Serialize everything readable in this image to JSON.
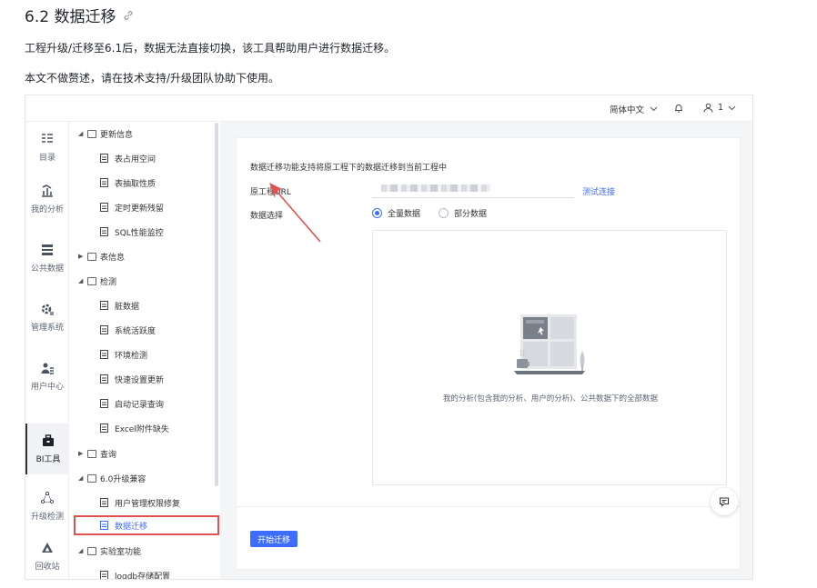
{
  "doc": {
    "title": "6.2 数据迁移",
    "para1": "工程升级/迁移至6.1后，数据无法直接切换，该工具帮助用户进行数据迁移。",
    "para2": "本文不做赘述，请在技术支持/升级团队协助下使用。"
  },
  "topbar": {
    "language": "简体中文",
    "user": "1"
  },
  "rail": [
    {
      "label": "目录",
      "icon": "catalog-icon"
    },
    {
      "label": "我的分析",
      "icon": "analysis-icon"
    },
    {
      "label": "公共数据",
      "icon": "public-data-icon"
    },
    {
      "label": "管理系统",
      "icon": "manage-system-icon"
    },
    {
      "label": "用户中心",
      "icon": "user-center-icon"
    },
    {
      "label": "BI工具",
      "icon": "bi-tools-icon",
      "active": true
    },
    {
      "label": "升级检测",
      "icon": "upgrade-check-icon"
    },
    {
      "label": "回收站",
      "icon": "recycle-bin-icon"
    }
  ],
  "tree": [
    {
      "type": "folder",
      "label": "更新信息",
      "expanded": true
    },
    {
      "type": "leaf",
      "label": "表占用空间"
    },
    {
      "type": "leaf",
      "label": "表抽取性质"
    },
    {
      "type": "leaf",
      "label": "定时更新残留"
    },
    {
      "type": "leaf",
      "label": "SQL性能监控"
    },
    {
      "type": "folder",
      "label": "表信息",
      "expanded": false
    },
    {
      "type": "folder",
      "label": "检测",
      "expanded": true
    },
    {
      "type": "leaf",
      "label": "脏数据"
    },
    {
      "type": "leaf",
      "label": "系统活跃度"
    },
    {
      "type": "leaf",
      "label": "环境检测"
    },
    {
      "type": "leaf",
      "label": "快速设置更新"
    },
    {
      "type": "leaf",
      "label": "启动记录查询"
    },
    {
      "type": "leaf",
      "label": "Excel附件缺失"
    },
    {
      "type": "folder",
      "label": "查询",
      "expanded": false
    },
    {
      "type": "folder",
      "label": "6.0升级兼容",
      "expanded": true
    },
    {
      "type": "leaf",
      "label": "用户管理权限修复"
    },
    {
      "type": "leaf",
      "label": "数据迁移",
      "selected": true
    },
    {
      "type": "folder",
      "label": "实验室功能",
      "expanded": true
    },
    {
      "type": "leaf",
      "label": "logdb存储配置"
    }
  ],
  "panel": {
    "description": "数据迁移功能支持将原工程下的数据迁移到当前工程中",
    "url_label": "原工程URL",
    "test_link": "测试连接",
    "data_label": "数据选择",
    "option_all": "全量数据",
    "option_partial": "部分数据",
    "selected_option": "全量数据",
    "empty_text": "我的分析(包含我的分析、用户的分析)、公共数据下的全部数据",
    "start_button": "开始迁移"
  },
  "colors": {
    "accent": "#3d6dff",
    "highlight_box": "#e05252",
    "annotation_arrow": "#e05252"
  }
}
